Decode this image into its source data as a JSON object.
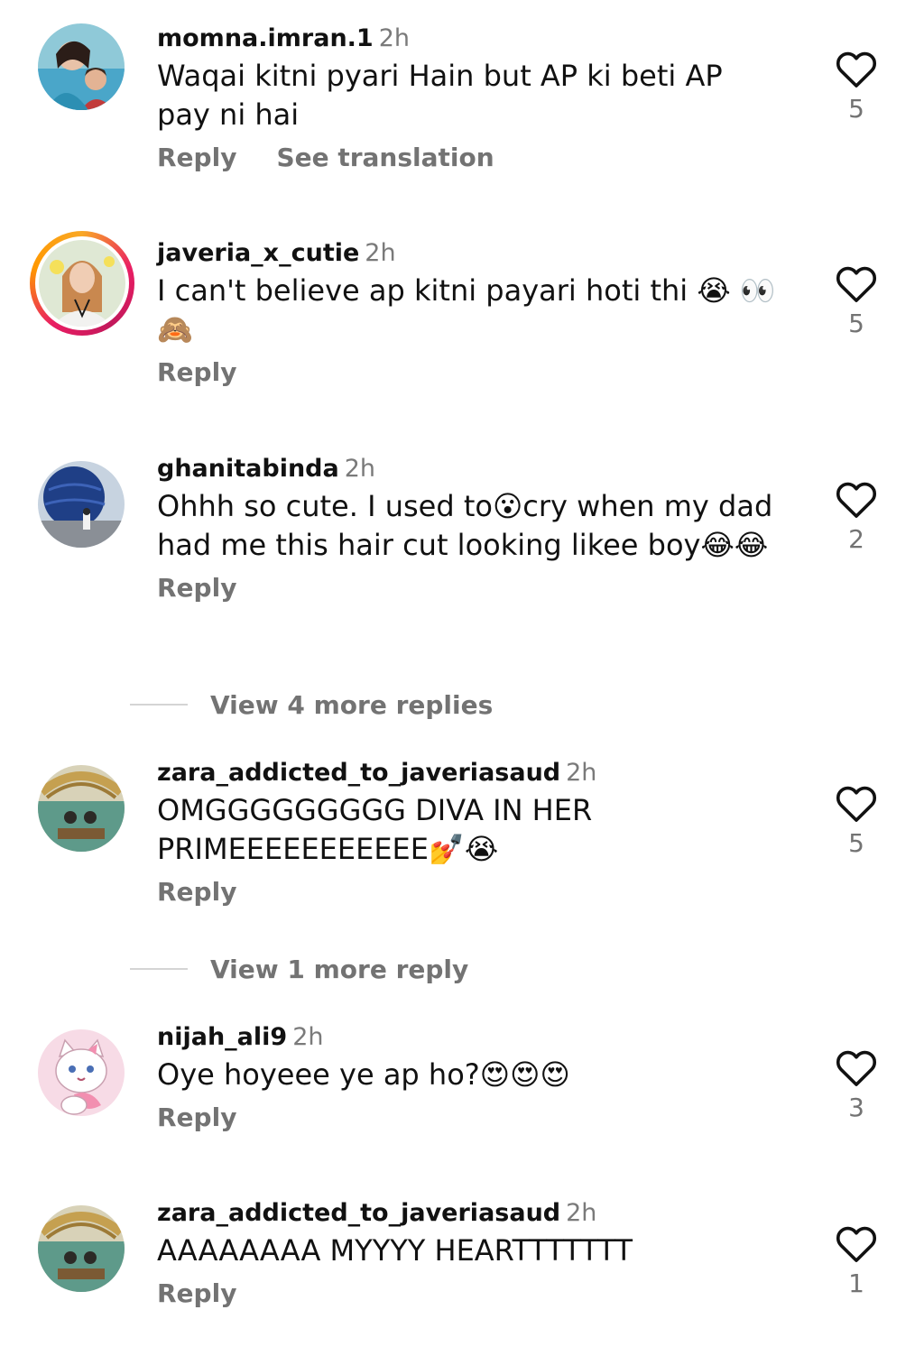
{
  "comments": [
    {
      "username": "momna.imran.1",
      "time": "2h",
      "text": "Waqai kitni pyari Hain but AP ki beti AP pay ni hai",
      "reply_label": "Reply",
      "translate_label": "See translation",
      "likes": "5",
      "avatar_icon": "user-photo"
    },
    {
      "username": "javeria_x_cutie",
      "time": "2h",
      "text": "I can't believe ap kitni payari hoti thi 😭 👀🙈",
      "reply_label": "Reply",
      "likes": "5",
      "avatar_icon": "user-photo-story-ring"
    },
    {
      "username": "ghanitabinda",
      "time": "2h",
      "text": "Ohhh so cute. I used to😮cry when my dad had me this hair cut looking likee boy😂😂",
      "reply_label": "Reply",
      "likes": "2",
      "avatar_icon": "user-photo",
      "view_more": "View 4 more replies"
    },
    {
      "username": "zara_addicted_to_javeriasaud",
      "time": "2h",
      "text": "OMGGGGGGGGG DIVA IN HER PRIMEEEEEEEEEEE💅😭",
      "reply_label": "Reply",
      "likes": "5",
      "avatar_icon": "user-photo",
      "view_more": "View 1 more reply"
    },
    {
      "username": "nijah_ali9",
      "time": "2h",
      "text": "Oye hoyeee ye ap ho?😍😍😍",
      "reply_label": "Reply",
      "likes": "3",
      "avatar_icon": "cat-cartoon"
    },
    {
      "username": "zara_addicted_to_javeriasaud",
      "time": "2h",
      "text": "AAAAAAAA MYYYY HEARTTTTTTT",
      "reply_label": "Reply",
      "likes": "1",
      "avatar_icon": "user-photo"
    }
  ],
  "colors": {
    "text": "#111111",
    "muted": "#737373",
    "story_ring": "#e91e63"
  }
}
